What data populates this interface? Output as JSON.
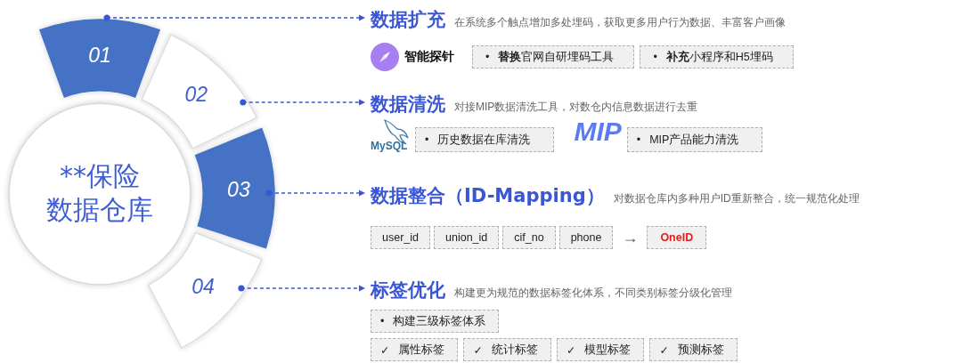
{
  "hub": {
    "lines": [
      "**保险",
      "数据仓库"
    ]
  },
  "segments": [
    {
      "label": "01",
      "selected": true
    },
    {
      "label": "02",
      "selected": false
    },
    {
      "label": "03",
      "selected": true
    },
    {
      "label": "04",
      "selected": false
    }
  ],
  "sections": [
    {
      "title": "数据扩充",
      "description": "在系统多个触点增加多处埋码，获取更多用户行为数据、丰富客户画像",
      "rows": [
        [
          {
            "kind": "brand",
            "text": "智能探针"
          },
          {
            "kind": "tag",
            "marker": "•",
            "text": "**替换**官网自研埋码工具"
          },
          {
            "kind": "tag",
            "marker": "•",
            "text": "**补充**小程序和H5埋码"
          }
        ]
      ]
    },
    {
      "title": "数据清洗",
      "description": "对接MIP数据清洗工具，对数仓内信息数据进行去重",
      "rows": [
        [
          {
            "kind": "mysql_logo",
            "text": "MySQL"
          },
          {
            "kind": "tag",
            "marker": "•",
            "text": "历史数据在库清洗"
          },
          {
            "kind": "mip_logo",
            "text": "MIP"
          },
          {
            "kind": "tag",
            "marker": "•",
            "text": "MIP产品能力清洗"
          }
        ]
      ]
    },
    {
      "title": "数据整合（ID-Mapping）",
      "description": "对数据仓库内多种用户ID重新整合，统一规范化处理",
      "rows": [
        [
          {
            "kind": "chip",
            "text": "user_id"
          },
          {
            "kind": "chip",
            "text": "union_id"
          },
          {
            "kind": "chip",
            "text": "cif_no"
          },
          {
            "kind": "chip",
            "text": "phone"
          },
          {
            "kind": "arrow",
            "text": "→"
          },
          {
            "kind": "result",
            "text": "OneID"
          }
        ]
      ]
    },
    {
      "title": "标签优化",
      "description": "构建更为规范的数据标签化体系，不同类别标签分级化管理",
      "rows": [
        [
          {
            "kind": "tag",
            "marker": "•",
            "text": "构建三级标签体系"
          }
        ],
        [
          {
            "kind": "tag",
            "marker": "✓",
            "text": "属性标签"
          },
          {
            "kind": "tag",
            "marker": "✓",
            "text": "统计标签"
          },
          {
            "kind": "tag",
            "marker": "✓",
            "text": "模型标签"
          },
          {
            "kind": "tag",
            "marker": "✓",
            "text": "预测标签"
          }
        ]
      ]
    }
  ]
}
